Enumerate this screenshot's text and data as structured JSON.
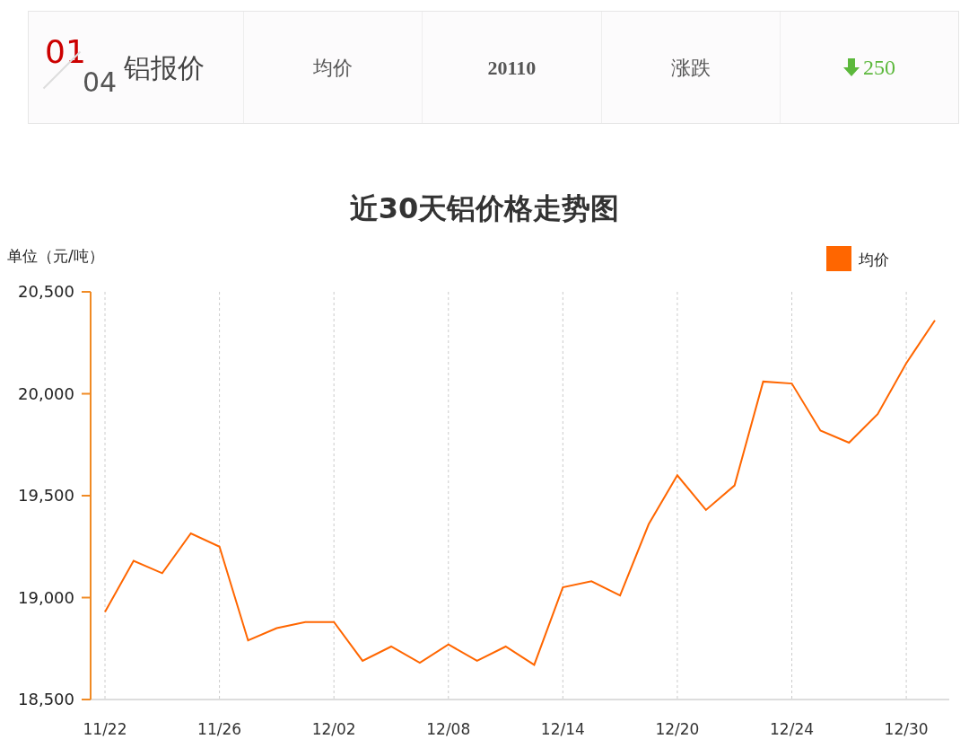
{
  "header": {
    "index": "01",
    "total": "04",
    "title": "铝报价",
    "avg_label": "均价",
    "avg_value": "20110",
    "change_label": "涨跌",
    "change": {
      "value": "250",
      "down": true
    }
  },
  "chart_title": "近30天铝价格走势图",
  "chart_data": {
    "type": "line",
    "ylabel": "单位（元/吨）",
    "categories": [
      "11/22",
      null,
      null,
      null,
      "11/26",
      null,
      null,
      null,
      "12/02",
      null,
      null,
      null,
      "12/08",
      null,
      null,
      null,
      "12/14",
      null,
      null,
      null,
      "12/20",
      null,
      null,
      null,
      "12/24",
      null,
      null,
      null,
      "12/30",
      null
    ],
    "grid": true,
    "ylim": [
      18500,
      20500
    ],
    "yticks": [
      {
        "value": 18500,
        "label": "18,500"
      },
      {
        "value": 19000,
        "label": "19,000"
      },
      {
        "value": 19500,
        "label": "19,500"
      },
      {
        "value": 20000,
        "label": "20,000"
      },
      {
        "value": 20500,
        "label": "20,500"
      }
    ],
    "series": [
      {
        "name": "均价",
        "color": "#ff6600",
        "values": [
          18930,
          19180,
          19120,
          19315,
          19250,
          18790,
          18850,
          18880,
          18880,
          18690,
          18760,
          18680,
          18770,
          18690,
          18760,
          18670,
          19050,
          19080,
          19010,
          19360,
          19600,
          19430,
          19550,
          20060,
          20050,
          19820,
          19760,
          19900,
          20150,
          20360
        ]
      }
    ]
  }
}
